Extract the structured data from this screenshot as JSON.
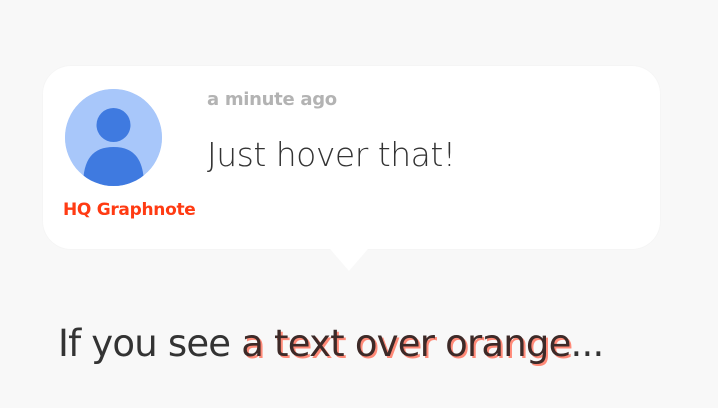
{
  "comment": {
    "timestamp": "a minute ago",
    "message": "Just hover that!",
    "author": "HQ Graphnote",
    "avatar_icon": "person-avatar-icon"
  },
  "caption": {
    "prefix": "If you see ",
    "highlight": "a text over orange",
    "suffix": "..."
  },
  "colors": {
    "background": "#f8f8f8",
    "bubble": "#ffffff",
    "author": "#ff3b13",
    "avatar_bg": "#a8c7fa",
    "avatar_fg": "#3f7ae0",
    "highlight_shadow": "#ff8a78"
  }
}
